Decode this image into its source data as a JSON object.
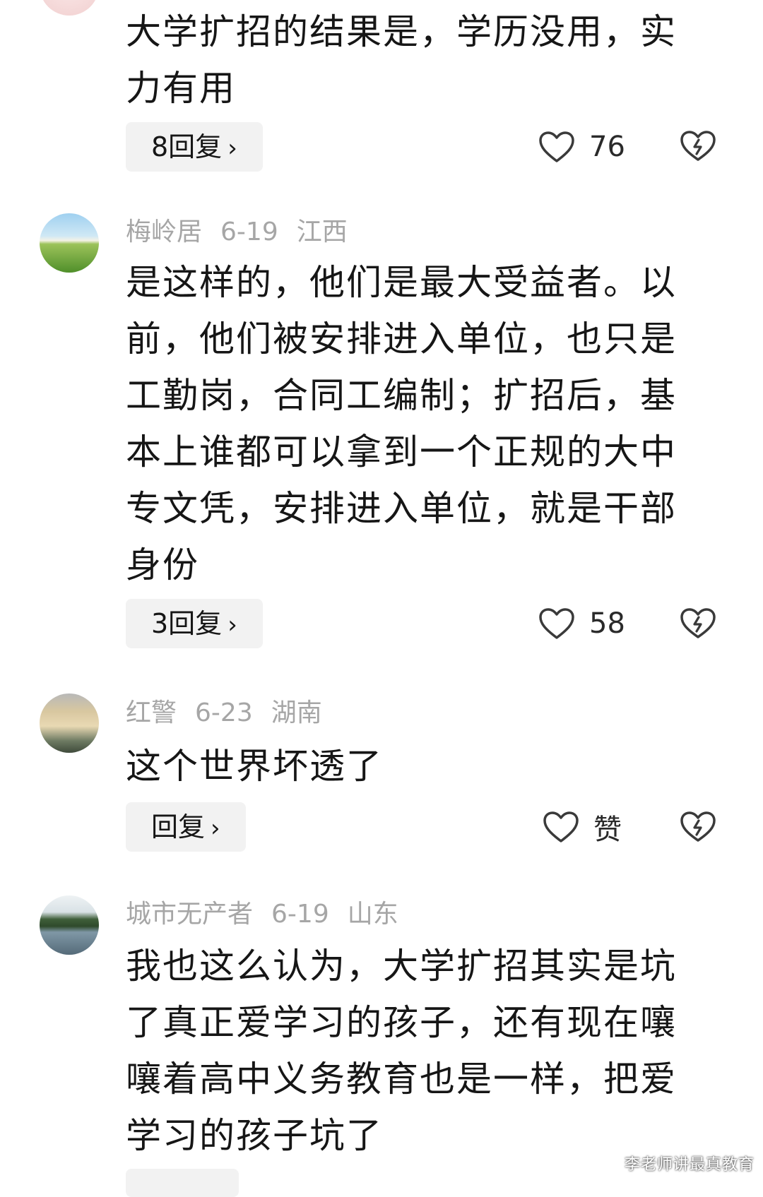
{
  "comments": [
    {
      "username": "",
      "date": "",
      "region": "",
      "text": "大学扩招的结果是，学历没用，实力有用",
      "reply_label": "8回复",
      "likes": "76"
    },
    {
      "username": "梅岭居",
      "date": "6-19",
      "region": "江西",
      "text": "是这样的，他们是最大受益者。以前，他们被安排进入单位，也只是工勤岗，合同工编制；扩招后，基本上谁都可以拿到一个正规的大中专文凭，安排进入单位，就是干部身份",
      "reply_label": "3回复",
      "likes": "58"
    },
    {
      "username": "红警",
      "date": "6-23",
      "region": "湖南",
      "text": "这个世界坏透了",
      "reply_label": "回复",
      "likes": "赞"
    },
    {
      "username": "城市无产者",
      "date": "6-19",
      "region": "山东",
      "text": "我也这么认为，大学扩招其实是坑了真正爱学习的孩子，还有现在嚷嚷着高中义务教育也是一样，把爱学习的孩子坑了",
      "reply_label": "",
      "likes": ""
    }
  ],
  "icons": {
    "like": "heart-outline-icon",
    "dislike": "broken-heart-icon",
    "chevron": "chevron-right-icon"
  },
  "watermark": "李老师讲最真教育"
}
